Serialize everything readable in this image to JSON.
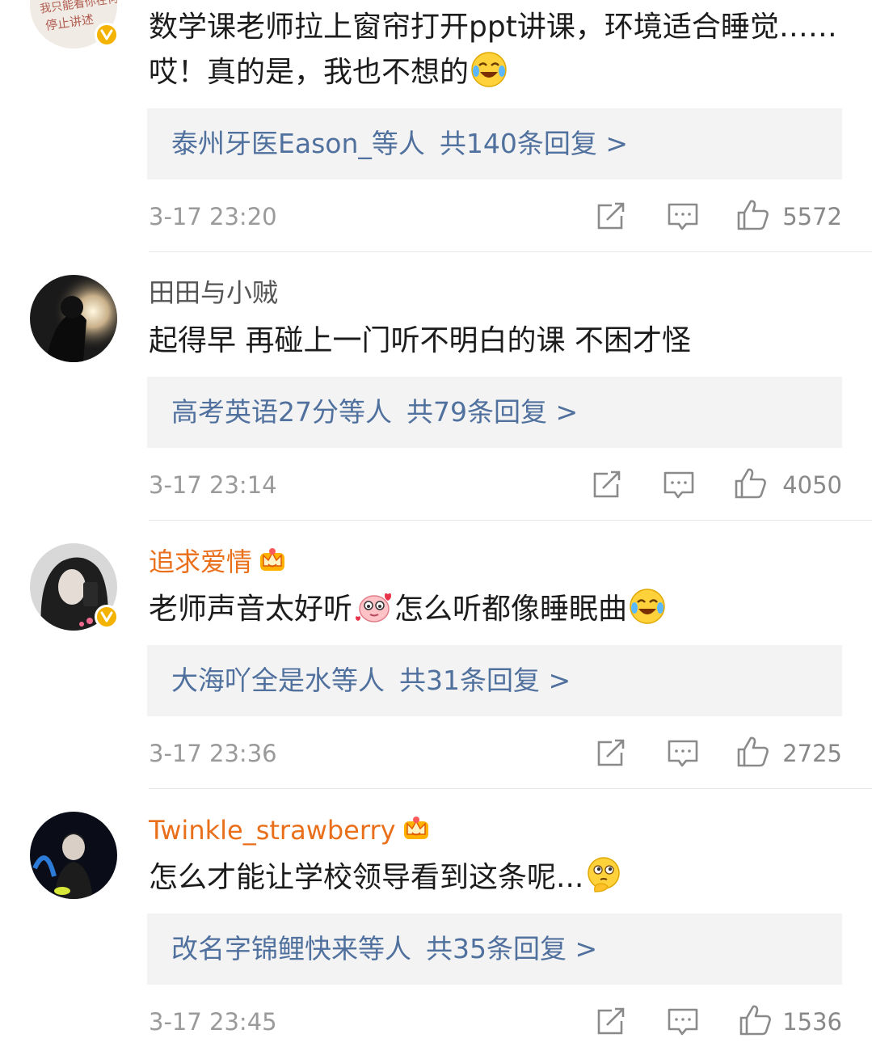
{
  "comments": [
    {
      "username": "",
      "text": "数学课老师拉上窗帘打开ppt讲课，环境适合睡觉……哎！真的是，我也不想的",
      "avatar_caption_line1": "我只能看你在何处",
      "avatar_caption_line2": "停止讲述",
      "replies_who": "泰州牙医Eason_等人",
      "replies_count": "共140条回复 >",
      "time": "3-17 23:20",
      "likes": "5572"
    },
    {
      "username": "田田与小贼",
      "text": "起得早 再碰上一门听不明白的课 不困才怪",
      "replies_who": "高考英语27分等人",
      "replies_count": "共79条回复 >",
      "time": "3-17 23:14",
      "likes": "4050"
    },
    {
      "username": "追求爱情",
      "text_part1": "老师声音太好听",
      "text_part2": "怎么听都像睡眠曲",
      "replies_who": "大海吖全是水等人",
      "replies_count": "共31条回复 >",
      "time": "3-17 23:36",
      "likes": "2725"
    },
    {
      "username": "Twinkle_strawberry",
      "text": "怎么才能让学校领导看到这条呢...",
      "replies_who": "改名字锦鲤快来等人",
      "replies_count": "共35条回复 >",
      "time": "3-17 23:45",
      "likes": "1536"
    }
  ],
  "icons": [
    "repost-icon",
    "comment-icon",
    "like-icon",
    "laugh-cry-emoji",
    "shy-emoji",
    "thinking-emoji",
    "crown-icon",
    "verified-badge-icon"
  ],
  "colors": {
    "link": "#50709e",
    "vip_name": "#ea6f1a",
    "muted": "#9a9a9a",
    "badge": "#f4b300",
    "reply_bg": "#f3f3f3"
  }
}
